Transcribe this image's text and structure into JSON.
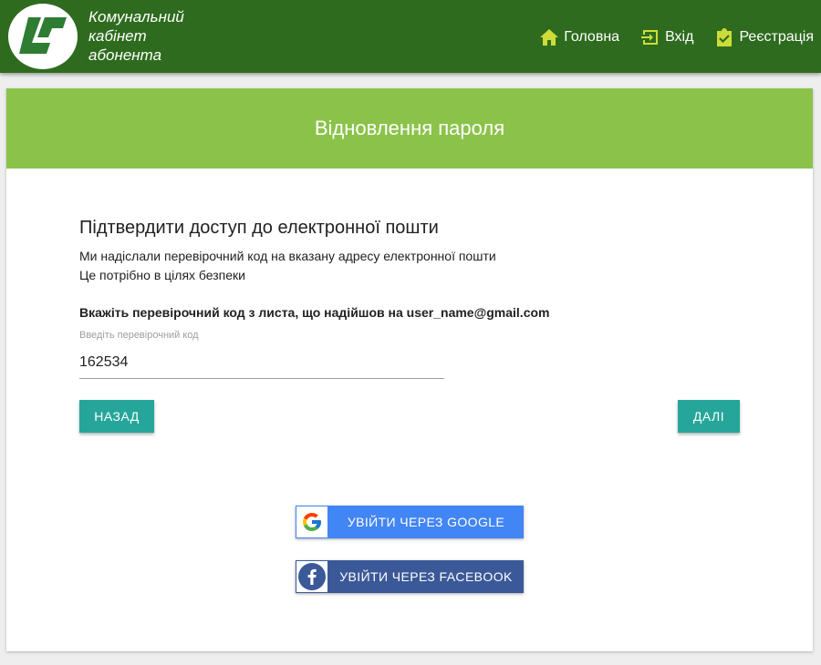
{
  "header": {
    "brand_line1": "Комунальний",
    "brand_line2": "кабінет",
    "brand_line3": "абонента",
    "nav": [
      {
        "label": "Головна",
        "icon": "home-icon"
      },
      {
        "label": "Вхід",
        "icon": "login-icon"
      },
      {
        "label": "Реєстрація",
        "icon": "clipboard-check-icon"
      }
    ]
  },
  "card": {
    "title": "Відновлення пароля",
    "section_title": "Підтвердити доступ до електронної пошти",
    "desc1": "Ми надіслали перевірочний код на вказану адресу електронної пошти",
    "desc2": "Це потрібно в цілях безпеки",
    "instruction": "Вкажіть перевірочний код з листа, що надійшов на user_name@gmail.com",
    "field_label": "Введіть перевірочний код",
    "code_value": "162534",
    "back_label": "НАЗАД",
    "next_label": "ДАЛІ",
    "google_label": "УВІЙТИ ЧЕРЕЗ GOOGLE",
    "facebook_label": "УВІЙТИ ЧЕРЕЗ FACEBOOK"
  },
  "colors": {
    "header_bg": "#2e6b1e",
    "card_header_bg": "#8bc34a",
    "accent_icon": "#cddc39",
    "button_teal": "#26a69a",
    "google_blue": "#4285f4",
    "facebook_blue": "#3b5998"
  }
}
